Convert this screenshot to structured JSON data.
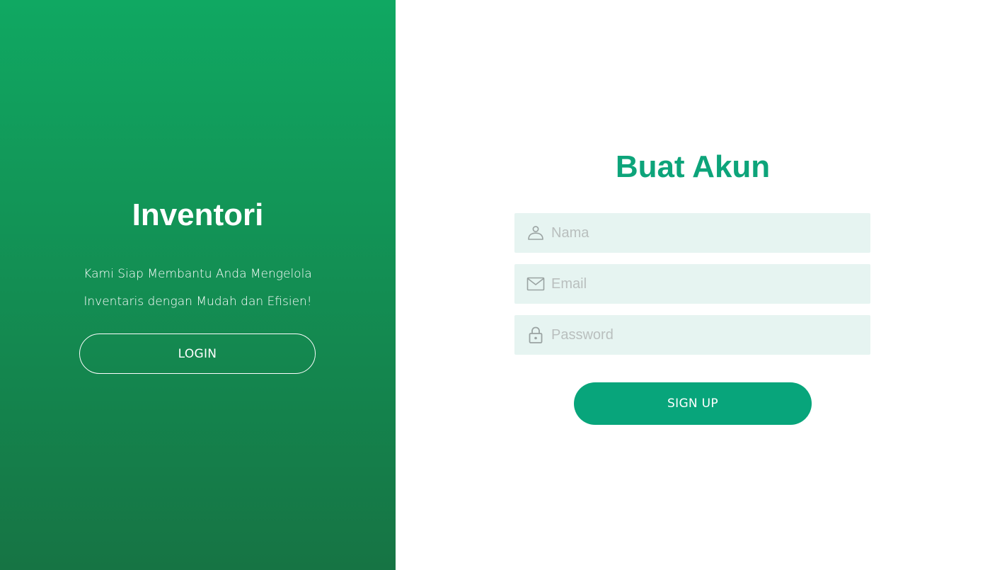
{
  "left": {
    "title": "Inventori",
    "tagline_line1": "Kami Siap Membantu Anda Mengelola",
    "tagline_line2": "Inventaris dengan Mudah dan Efisien!",
    "login_label": "LOGIN"
  },
  "right": {
    "title": "Buat Akun",
    "fields": {
      "nama": {
        "placeholder": "Nama",
        "value": "",
        "icon": "user-icon"
      },
      "email": {
        "placeholder": "Email",
        "value": "",
        "icon": "mail-icon"
      },
      "password": {
        "placeholder": "Password",
        "value": "",
        "icon": "lock-icon"
      }
    },
    "signup_label": "SIGN UP"
  },
  "colors": {
    "left_gradient_top": "#10a862",
    "left_gradient_bottom": "#167444",
    "accent": "#0da47a",
    "button": "#08a57b",
    "field_bg": "#e6f4f1"
  }
}
